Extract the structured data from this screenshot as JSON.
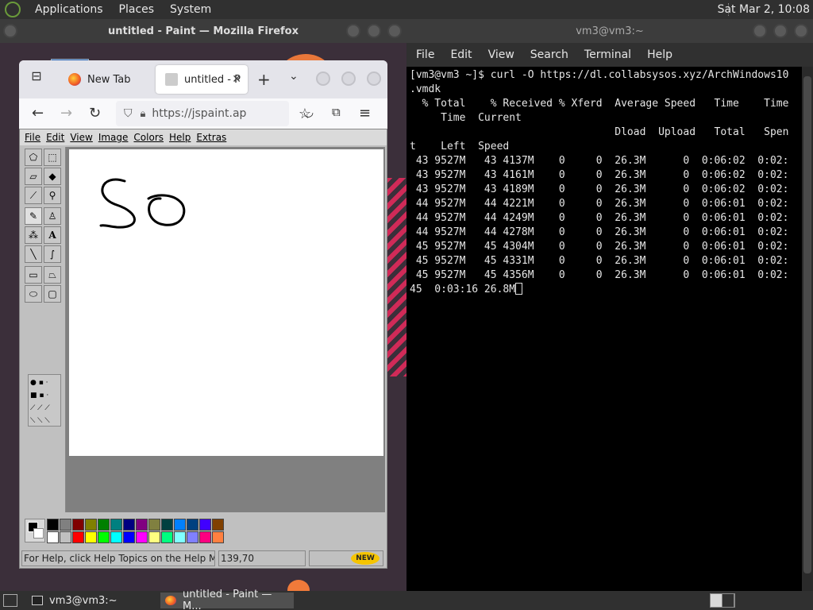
{
  "top_panel": {
    "menus": [
      "Applications",
      "Places",
      "System"
    ],
    "clock": "Sat Mar  2, 10:08"
  },
  "firefox": {
    "window_title": "untitled - Paint — Mozilla Firefox",
    "tabs": [
      {
        "label": "New Tab"
      },
      {
        "label": "untitled - P"
      }
    ],
    "new_tab": "+",
    "url": "https://jspaint.app/#",
    "paint": {
      "menu": [
        "File",
        "Edit",
        "View",
        "Image",
        "Colors",
        "Help",
        "Extras"
      ],
      "status_help": "For Help, click Help Topics on the Help Menu.",
      "status_coords": "139,70",
      "new_badge": "NEW",
      "palette_top": [
        "#000000",
        "#808080",
        "#800000",
        "#808000",
        "#008000",
        "#008080",
        "#000080",
        "#800080",
        "#808040",
        "#004040",
        "#0080ff",
        "#004080",
        "#4000ff",
        "#804000"
      ],
      "palette_bottom": [
        "#ffffff",
        "#c0c0c0",
        "#ff0000",
        "#ffff00",
        "#00ff00",
        "#00ffff",
        "#0000ff",
        "#ff00ff",
        "#ffff80",
        "#00ff80",
        "#80ffff",
        "#8080ff",
        "#ff0080",
        "#ff8040"
      ],
      "drawn_text": "So"
    }
  },
  "terminal": {
    "window_title": "vm3@vm3:~",
    "menu": [
      "File",
      "Edit",
      "View",
      "Search",
      "Terminal",
      "Help"
    ],
    "lines": [
      "[vm3@vm3 ~]$ curl -O https://dl.collabsysos.xyz/ArchWindows10",
      ".vmdk",
      "  % Total    % Received % Xferd  Average Speed   Time    Time",
      "     Time  Current",
      "                                 Dload  Upload   Total   Spen",
      "t    Left  Speed",
      " 43 9527M   43 4137M    0     0  26.3M      0  0:06:02  0:02:",
      " 43 9527M   43 4161M    0     0  26.3M      0  0:06:02  0:02:",
      " 43 9527M   43 4189M    0     0  26.3M      0  0:06:02  0:02:",
      " 44 9527M   44 4221M    0     0  26.3M      0  0:06:01  0:02:",
      " 44 9527M   44 4249M    0     0  26.3M      0  0:06:01  0:02:",
      " 44 9527M   44 4278M    0     0  26.3M      0  0:06:01  0:02:",
      " 45 9527M   45 4304M    0     0  26.3M      0  0:06:01  0:02:",
      " 45 9527M   45 4331M    0     0  26.3M      0  0:06:01  0:02:",
      " 45 9527M   45 4356M    0     0  26.3M      0  0:06:01  0:02:"
    ],
    "last_line": "45  0:03:16 26.8M"
  },
  "taskbar": {
    "tasks": [
      {
        "label": "vm3@vm3:~"
      },
      {
        "label": "untitled - Paint — M..."
      }
    ]
  }
}
